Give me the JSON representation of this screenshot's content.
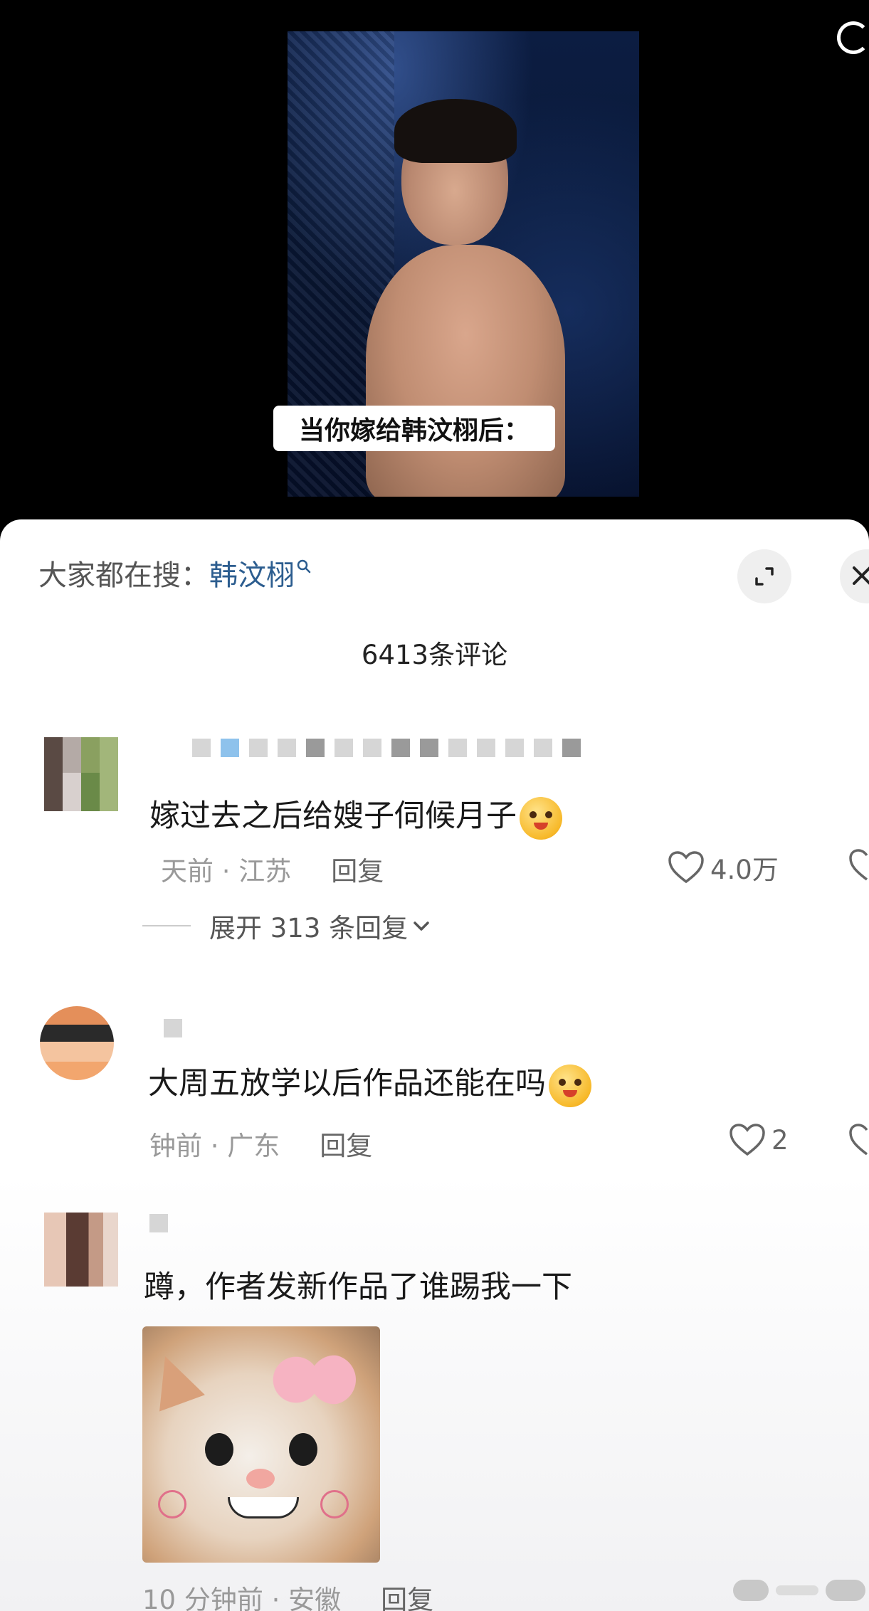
{
  "video": {
    "caption": "当你嫁给韩汶栩后："
  },
  "comments_panel": {
    "search_label": "大家都在搜：",
    "search_term": "韩汶栩",
    "count_label": "6413条评论",
    "comments": [
      {
        "text": "嫁过去之后给嫂子伺候月子",
        "meta": "天前 · 江苏",
        "reply_label": "回复",
        "likes": "4.0万",
        "expand_label": "展开 313 条回复"
      },
      {
        "text": "大周五放学以后作品还能在吗",
        "meta": "钟前 · 广东",
        "reply_label": "回复",
        "likes": "2"
      },
      {
        "text": "蹲，作者发新作品了谁踢我一下",
        "meta": "10 分钟前 · 安徽",
        "reply_label": "回复"
      }
    ]
  },
  "colors": {
    "link": "#2c5d8f",
    "meta": "#999999",
    "text": "#1a1a1a"
  }
}
